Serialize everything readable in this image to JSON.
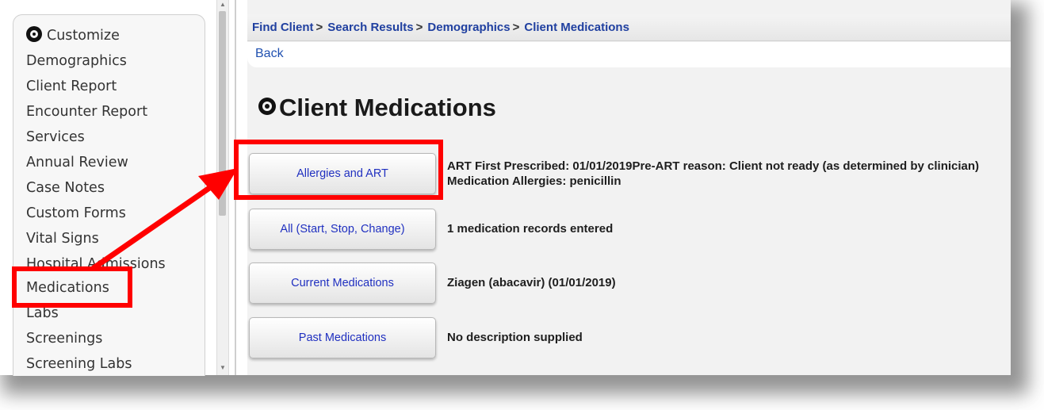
{
  "sidebar": {
    "items": [
      {
        "label": "Customize"
      },
      {
        "label": "Demographics"
      },
      {
        "label": "Client Report"
      },
      {
        "label": "Encounter Report"
      },
      {
        "label": "Services"
      },
      {
        "label": "Annual Review"
      },
      {
        "label": "Case Notes"
      },
      {
        "label": "Custom Forms"
      },
      {
        "label": "Vital Signs"
      },
      {
        "label": "Hospital Admissions"
      },
      {
        "label": "Medications"
      },
      {
        "label": "Labs"
      },
      {
        "label": "Screenings"
      },
      {
        "label": "Screening Labs"
      }
    ]
  },
  "breadcrumb": {
    "items": [
      {
        "label": "Find Client"
      },
      {
        "label": "Search Results"
      },
      {
        "label": "Demographics"
      },
      {
        "label": "Client Medications"
      }
    ],
    "separator": ">"
  },
  "back_link": "Back",
  "page_title": "Client Medications",
  "sections": [
    {
      "button": "Allergies and ART",
      "description": "ART First Prescribed: 01/01/2019Pre-ART reason: Client not ready (as determined by clinician) Medication Allergies: penicillin"
    },
    {
      "button": "All (Start, Stop, Change)",
      "description": "1 medication records entered"
    },
    {
      "button": "Current Medications",
      "description": "Ziagen (abacavir) (01/01/2019)"
    },
    {
      "button": "Past Medications",
      "description": "No description supplied"
    }
  ],
  "colors": {
    "link": "#2040a0",
    "button_text": "#2030c0",
    "annotation": "#ff0000"
  }
}
